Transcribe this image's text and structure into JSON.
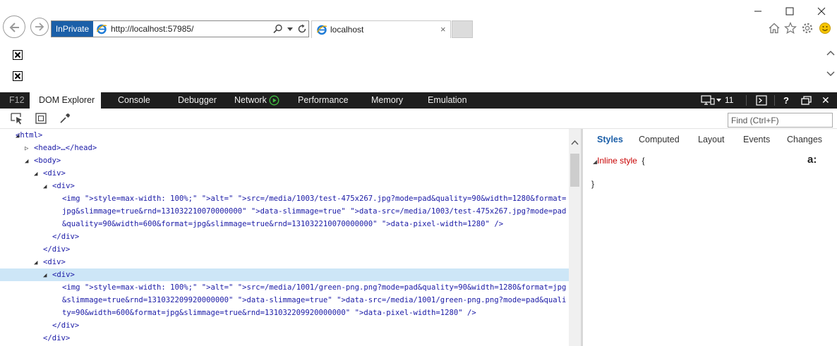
{
  "browser": {
    "inprivate_label": "InPrivate",
    "url": "http://localhost:57985/",
    "tab_title": "localhost",
    "tab_close": "×"
  },
  "f12": {
    "label": "F12",
    "tabs": [
      "DOM Explorer",
      "Console",
      "Debugger",
      "Network",
      "Performance",
      "Memory",
      "Emulation"
    ],
    "active_tab": "DOM Explorer",
    "emulation_version": "11",
    "help": "?",
    "close": "✕"
  },
  "dom_toolbar": {
    "find_placeholder": "Find (Ctrl+F)"
  },
  "dom_tree": {
    "lines": [
      "<html>",
      "<head>…</head>",
      "<body>",
      "<div>",
      "<div>",
      "<img style=\"max-width: 100%;\" alt=\"\" src=\"/media/1003/test-475x267.jpg?mode=pad&quality=90&width=1280&format=jpg&slimmage=true&rnd=131032210070000000\" data-slimmage=\"true\" data-src=\"/media/1003/test-475x267.jpg?mode=pad&quality=90&width=600&format=jpg&slimmage=true&rnd=131032210070000000\" data-pixel-width=\"1280\" />",
      "</div>",
      "</div>",
      "<div>",
      "<div>",
      "<img style=\"max-width: 100%;\" alt=\"\" src=\"/media/1001/green-png.png?mode=pad&quality=90&width=1280&format=jpg&slimmage=true&rnd=131032209920000000\" data-slimmage=\"true\" data-src=\"/media/1001/green-png.png?mode=pad&quality=90&width=600&format=jpg&slimmage=true&rnd=131032209920000000\" data-pixel-width=\"1280\" />",
      "</div>",
      "</div>"
    ],
    "selected": "<div>"
  },
  "styles_pane": {
    "tabs": [
      "Styles",
      "Computed",
      "Layout",
      "Events",
      "Changes"
    ],
    "active_tab": "Styles",
    "inline_style_label": "Inline style",
    "open_brace": "{",
    "close_brace": "}",
    "font_icon": "a:"
  },
  "colors": {
    "inprivate_bg": "#1b5fa8",
    "f12_bar_bg": "#1e1e1e",
    "selected_row_bg": "#cde6f7",
    "tag_color": "#1a1aa6",
    "attr_name_color": "#c80000",
    "active_styles_tab": "#1b5fa8"
  }
}
